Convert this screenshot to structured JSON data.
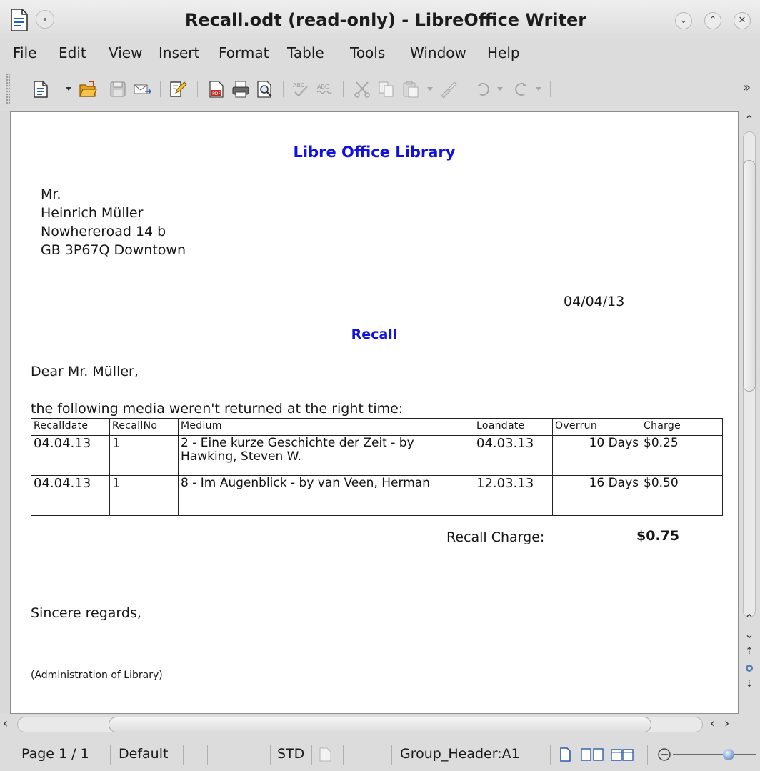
{
  "window": {
    "title": "Recall.odt (read-only) - LibreOffice Writer",
    "controls": [
      "minimize",
      "maximize",
      "close"
    ]
  },
  "menu": [
    "File",
    "Edit",
    "View",
    "Insert",
    "Format",
    "Table",
    "Tools",
    "Window",
    "Help"
  ],
  "toolbar": {
    "icons": [
      "new-document-icon",
      "open-icon",
      "save-icon",
      "email-icon",
      "edit-file-icon",
      "export-pdf-icon",
      "print-icon",
      "print-preview-icon",
      "spellcheck-icon",
      "autospellcheck-icon",
      "cut-icon",
      "copy-icon",
      "paste-icon",
      "clone-formatting-icon",
      "undo-icon",
      "redo-icon"
    ],
    "overflow": "»"
  },
  "document": {
    "header": "Libre Office Library",
    "address": [
      "Mr.",
      "Heinrich Müller",
      "Nowhereroad 14 b",
      "GB 3P67Q Downtown"
    ],
    "date": "04/04/13",
    "subject": "Recall",
    "salutation": "Dear Mr. Müller,",
    "intro": "the following media weren't returned at the right time:",
    "table": {
      "headers": [
        "Recalldate",
        "RecallNo",
        "Medium",
        "Loandate",
        "Overrun",
        "Charge"
      ],
      "rows": [
        [
          "04.04.13",
          "1",
          "2 - Eine kurze Geschichte der Zeit - by Hawking, Steven W.",
          "04.03.13",
          "10 Days",
          "$0.25"
        ],
        [
          "04.04.13",
          "1",
          "8 - Im  Augenblick - by van Veen, Herman",
          "12.03.13",
          "16 Days",
          "$0.50"
        ]
      ]
    },
    "total_label": "Recall Charge:",
    "total_value": "$0.75",
    "closing": "Sincere regards,",
    "signature": "(Administration of Library)"
  },
  "statusbar": {
    "page": "Page 1 / 1",
    "style": "Default",
    "mode": "STD",
    "section": "Group_Header:A1"
  }
}
